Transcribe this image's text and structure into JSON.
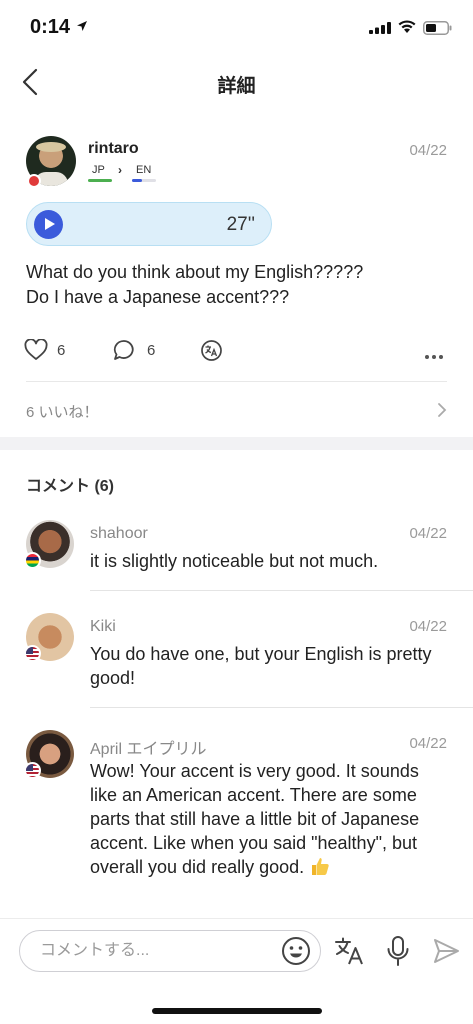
{
  "status_bar": {
    "time": "0:14",
    "icons": [
      "location-arrow-icon",
      "signal-bars-icon",
      "wifi-icon",
      "battery-icon"
    ]
  },
  "nav": {
    "title": "詳細",
    "back_icon": "chevron-left-icon"
  },
  "post": {
    "username": "rintaro",
    "date": "04/22",
    "native_language": "JP",
    "learning_language": "EN",
    "status_color": "#e03a3a",
    "voice": {
      "duration": "27''",
      "icon": "play-icon"
    },
    "text_lines": [
      "What do you think about my English?????",
      "Do I have a Japanese accent???"
    ],
    "like_count": "6",
    "comment_count": "6",
    "likes_summary": "6 いいね！"
  },
  "comments_section": {
    "header": "コメント (6)",
    "comments": [
      {
        "name": "shahoor",
        "date": "04/22",
        "flag": "mauritius-flag-icon",
        "text": "it is slightly noticeable but not much."
      },
      {
        "name": "Kiki",
        "date": "04/22",
        "flag": "us-flag-icon",
        "text": "You do have one, but your English is pretty good!"
      },
      {
        "name": "April エイプリル",
        "date": "04/22",
        "flag": "us-flag-icon",
        "text": "Wow! Your accent is very good. It sounds like an American accent. There are some parts that still have a little bit of Japanese accent. Like when you said \"healthy\", but overall you did really good.",
        "emoji": "thumbs-up-icon"
      }
    ]
  },
  "input_bar": {
    "placeholder": "コメントする...",
    "value": ""
  },
  "colors": {
    "accent": "#3b5bdb",
    "voice_bubble": "#ddeffa",
    "native_bar": "#4caf50"
  }
}
